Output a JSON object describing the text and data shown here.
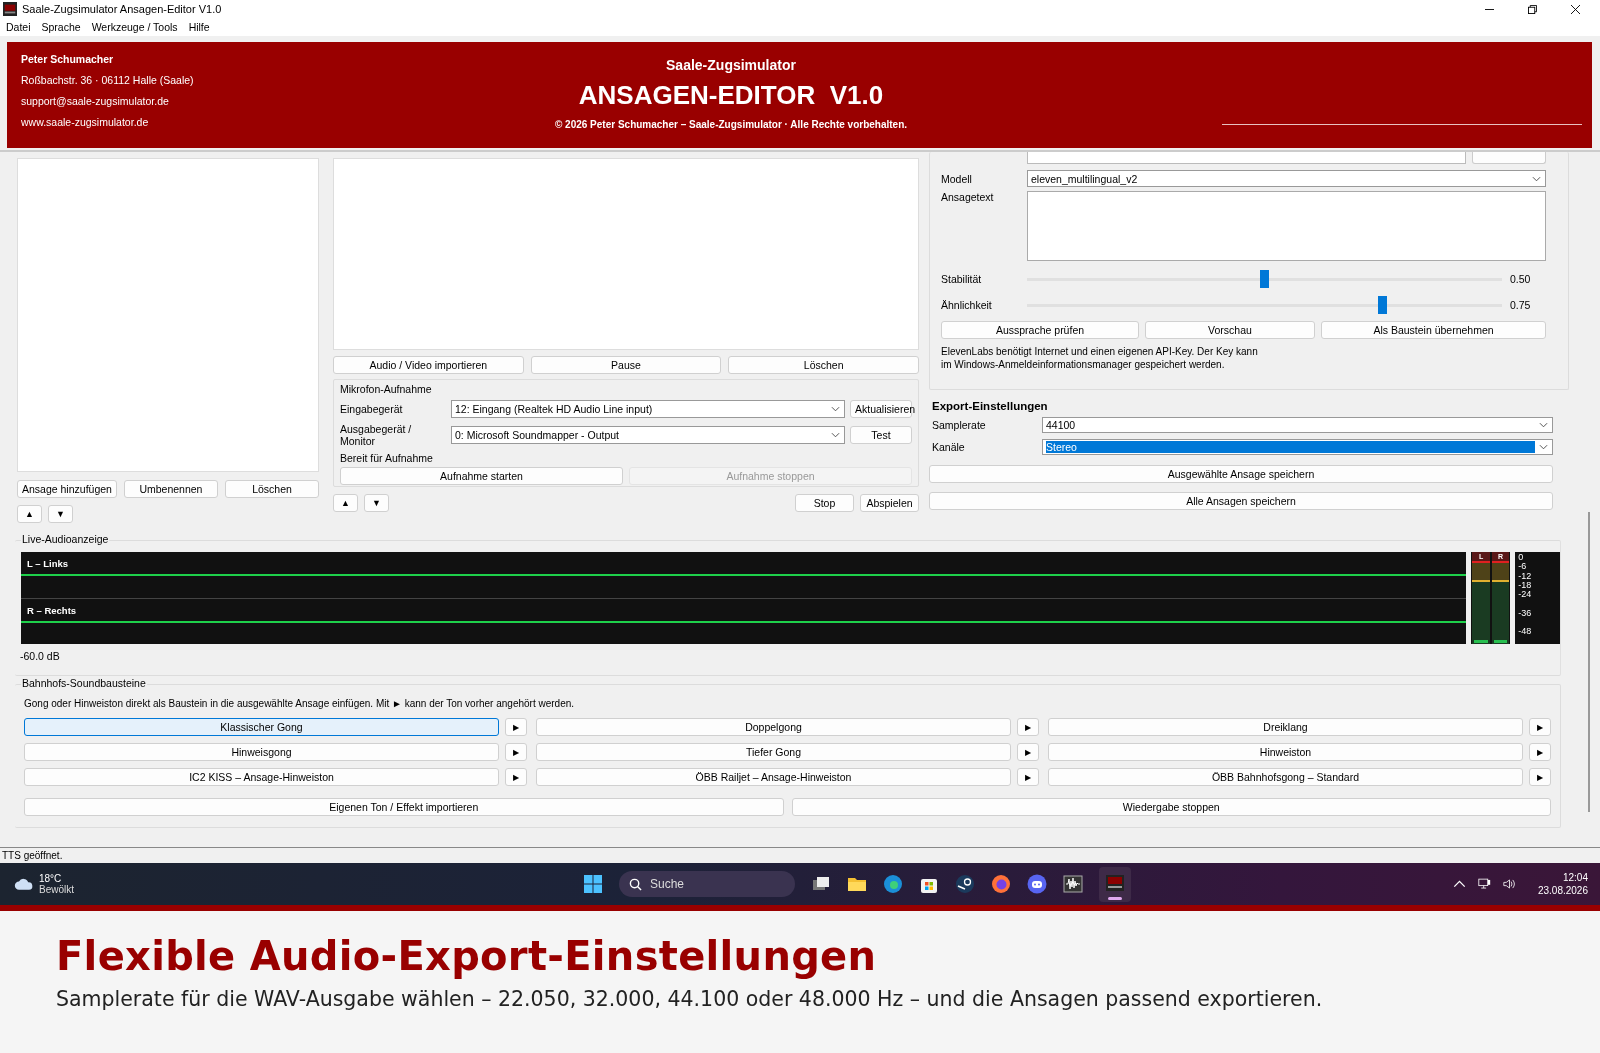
{
  "window": {
    "title": "Saale-Zugsimulator Ansagen-Editor V1.0"
  },
  "menu": [
    "Datei",
    "Sprache",
    "Werkzeuge / Tools",
    "Hilfe"
  ],
  "header": {
    "contact": [
      "Peter Schumacher",
      "Roßbachstr. 36 · 06112 Halle (Saale)",
      "support@saale-zugsimulator.de",
      "www.saale-zugsimulator.de"
    ],
    "app_name": "Saale-Zugsimulator",
    "title": "ANSAGEN-EDITOR  V1.0",
    "copyright": "© 2026 Peter Schumacher – Saale-Zugsimulator · Alle Rechte vorbehalten."
  },
  "announcements": {
    "buttons": [
      "Ansage hinzufügen",
      "Umbenennen",
      "Löschen"
    ],
    "move": [
      "▲",
      "▼"
    ]
  },
  "media": {
    "buttons": [
      "Audio / Video importieren",
      "Pause",
      "Löschen"
    ],
    "mic": {
      "title": "Mikrofon-Aufnahme",
      "input_label": "Eingabegerät",
      "input_value": "12: Eingang (Realtek HD Audio Line input)",
      "refresh": "Aktualisieren",
      "output_label": "Ausgabegerät / Monitor",
      "output_value": "0: Microsoft Soundmapper - Output",
      "test": "Test",
      "status": "Bereit für Aufnahme",
      "buttons": [
        {
          "label": "Aufnahme starten",
          "disabled": false
        },
        {
          "label": "Aufnahme stoppen",
          "disabled": true
        }
      ]
    },
    "move": [
      "▲",
      "▼"
    ],
    "playback": [
      "Stop",
      "Abspielen"
    ]
  },
  "tts": {
    "model_label": "Modell",
    "model_value": "eleven_multilingual_v2",
    "text_label": "Ansagetext",
    "sliders": [
      {
        "label": "Stabilität",
        "level": 0.5,
        "reading": "0.50"
      },
      {
        "label": "Ähnlichkeit",
        "level": 0.75,
        "reading": "0.75"
      }
    ],
    "buttons": [
      "Aussprache prüfen",
      "Vorschau",
      "Als Baustein übernehmen"
    ],
    "info": "ElevenLabs benötigt Internet und einen eigenen API-Key. Der Key kann\nim Windows-Anmeldeinformationsmanager gespeichert werden."
  },
  "export": {
    "title": "Export-Einstellungen",
    "fields": [
      {
        "label": "Samplerate",
        "value": "44100",
        "selected": false
      },
      {
        "label": "Kanäle",
        "value": "Stereo",
        "selected": true
      }
    ],
    "buttons": [
      "Ausgewählte Ansage speichern",
      "Alle Ansagen speichern"
    ]
  },
  "live": {
    "title": "Live-Audioanzeige",
    "channels": [
      "L – Links",
      "R – Rechts"
    ],
    "reading": "-60.0 dB",
    "meter_labels": [
      "L",
      "R"
    ],
    "scale": [
      "0",
      "-6",
      "-12",
      "-18",
      "-24",
      "-36",
      "-48"
    ]
  },
  "sounds": {
    "title": "Bahnhofs-Soundbausteine",
    "hint": "Gong oder Hinweiston direkt als Baustein in die ausgewählte Ansage einfügen. Mit ► kann der Ton vorher angehört werden.",
    "items": [
      {
        "label": "Klassischer Gong",
        "selected": true
      },
      {
        "label": "Doppelgong",
        "selected": false
      },
      {
        "label": "Dreiklang",
        "selected": false
      },
      {
        "label": "Hinweisgong",
        "selected": false
      },
      {
        "label": "Tiefer Gong",
        "selected": false
      },
      {
        "label": "Hinweiston",
        "selected": false
      },
      {
        "label": "IC2 KISS – Ansage-Hinweiston",
        "selected": false
      },
      {
        "label": "ÖBB Railjet – Ansage-Hinweiston",
        "selected": false
      },
      {
        "label": "ÖBB Bahnhofsgong – Standard",
        "selected": false
      }
    ],
    "play": "▶",
    "buttons": [
      "Eigenen Ton / Effekt importieren",
      "Wiedergabe stoppen"
    ]
  },
  "status_bar": "TTS geöffnet.",
  "taskbar": {
    "temperature": "18°C",
    "weather": "Bewölkt",
    "search_placeholder": "Suche",
    "time": "12:04",
    "date": "23.08.2026"
  },
  "caption": {
    "title": "Flexible Audio-Export-Einstellungen",
    "text": "Samplerate für die WAV-Ausgabe wählen – 22.050, 32.000, 44.100 oder 48.000 Hz – und die Ansagen passend exportieren."
  }
}
